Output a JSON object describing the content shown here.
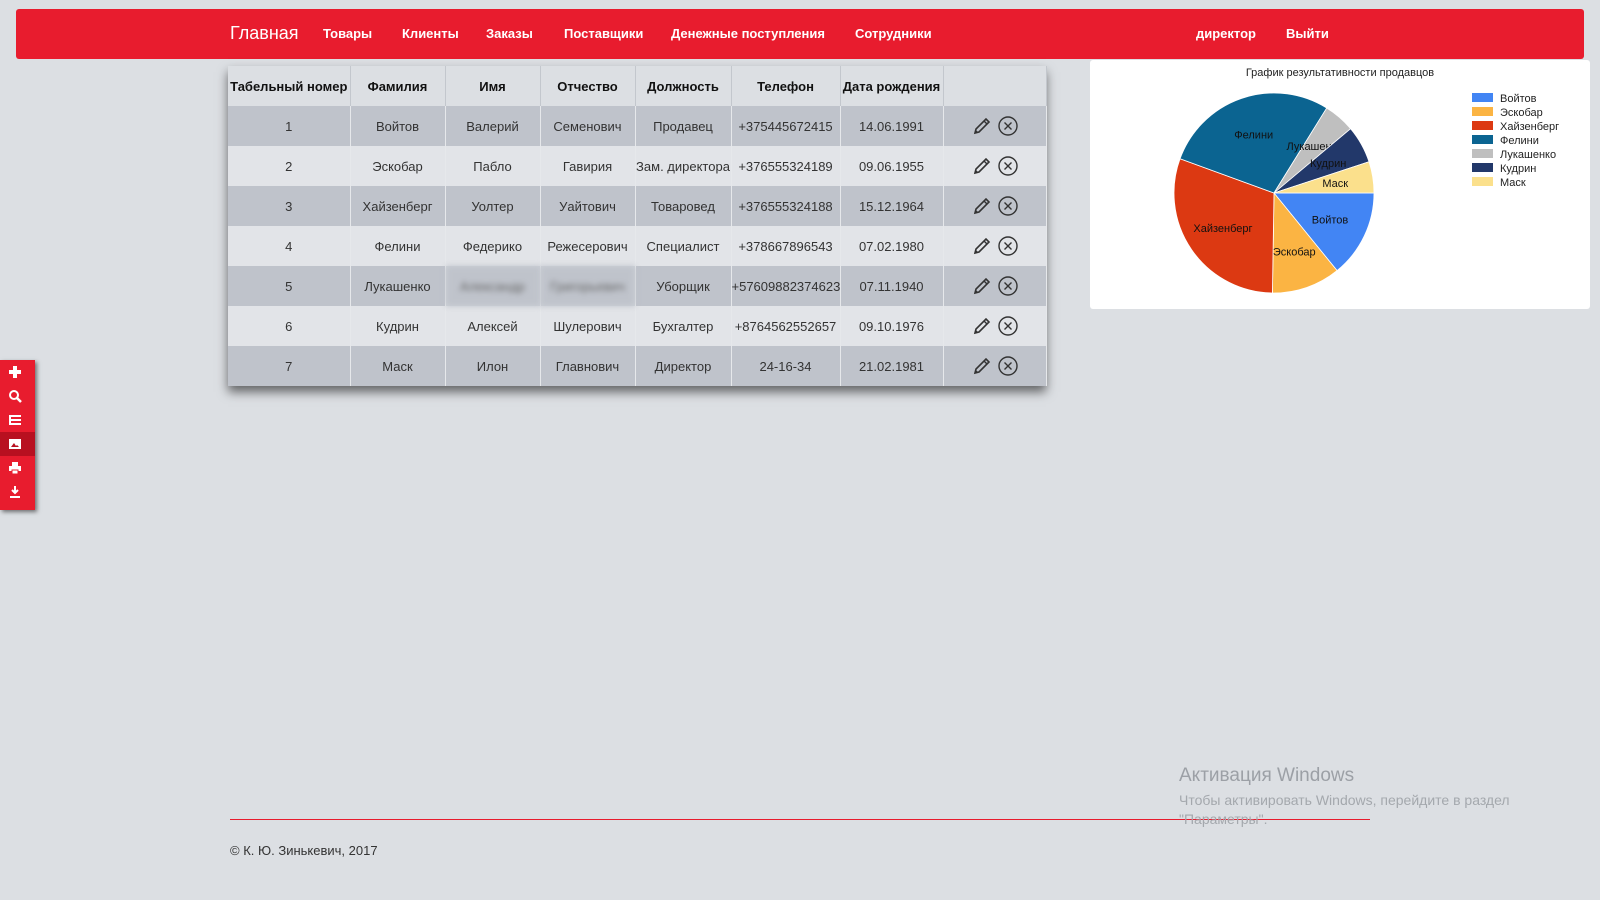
{
  "nav": {
    "brand": "Главная",
    "items": [
      "Товары",
      "Клиенты",
      "Заказы",
      "Поставщики",
      "Денежные поступления",
      "Сотрудники"
    ],
    "user": "директор",
    "logout": "Выйти"
  },
  "table": {
    "headers": [
      "Табельный номер",
      "Фамилия",
      "Имя",
      "Отчество",
      "Должность",
      "Телефон",
      "Дата рождения",
      ""
    ],
    "rows": [
      [
        "1",
        "Войтов",
        "Валерий",
        "Семенович",
        "Продавец",
        "+375445672415",
        "14.06.1991"
      ],
      [
        "2",
        "Эскобар",
        "Пабло",
        "Гавирия",
        "Зам. директора",
        "+376555324189",
        "09.06.1955"
      ],
      [
        "3",
        "Хайзенберг",
        "Уолтер",
        "Уайтович",
        "Товаровед",
        "+376555324188",
        "15.12.1964"
      ],
      [
        "4",
        "Фелини",
        "Федерико",
        "Режесерович",
        "Специалист",
        "+378667896543",
        "07.02.1980"
      ],
      [
        "5",
        "Лукашенко",
        "Александр",
        "Григорьевич",
        "Уборщик",
        "+57609882374623",
        "07.11.1940"
      ],
      [
        "6",
        "Кудрин",
        "Алексей",
        "Шулерович",
        "Бухгалтер",
        "+8764562552657",
        "09.10.1976"
      ],
      [
        "7",
        "Маск",
        "Илон",
        "Главнович",
        "Директор",
        "24-16-34",
        "21.02.1981"
      ]
    ]
  },
  "chart_data": {
    "type": "pie",
    "title": "График результативности продавцов",
    "categories": [
      "Войтов",
      "Эскобар",
      "Хайзенберг",
      "Фелини",
      "Лукашенко",
      "Кудрин",
      "Маск"
    ],
    "values": [
      14,
      11,
      30,
      28,
      5,
      6,
      5
    ],
    "colors": [
      "#4285f4",
      "#fbb443",
      "#dc3912",
      "#0b6491",
      "#bfbfbf",
      "#22386a",
      "#fbe08c"
    ],
    "legend_position": "right"
  },
  "toolbar": {
    "icons": [
      "plus-icon",
      "search-icon",
      "list-icon",
      "image-icon",
      "print-icon",
      "export-icon"
    ]
  },
  "footer": {
    "text": "© К. Ю. Зинькевич, 2017"
  },
  "watermark": {
    "title": "Активация Windows",
    "text": "Чтобы активировать Windows, перейдите в раздел \"Параметры\"."
  },
  "colors": {
    "brand": "#e81c2e",
    "background": "#dcdfe3"
  }
}
